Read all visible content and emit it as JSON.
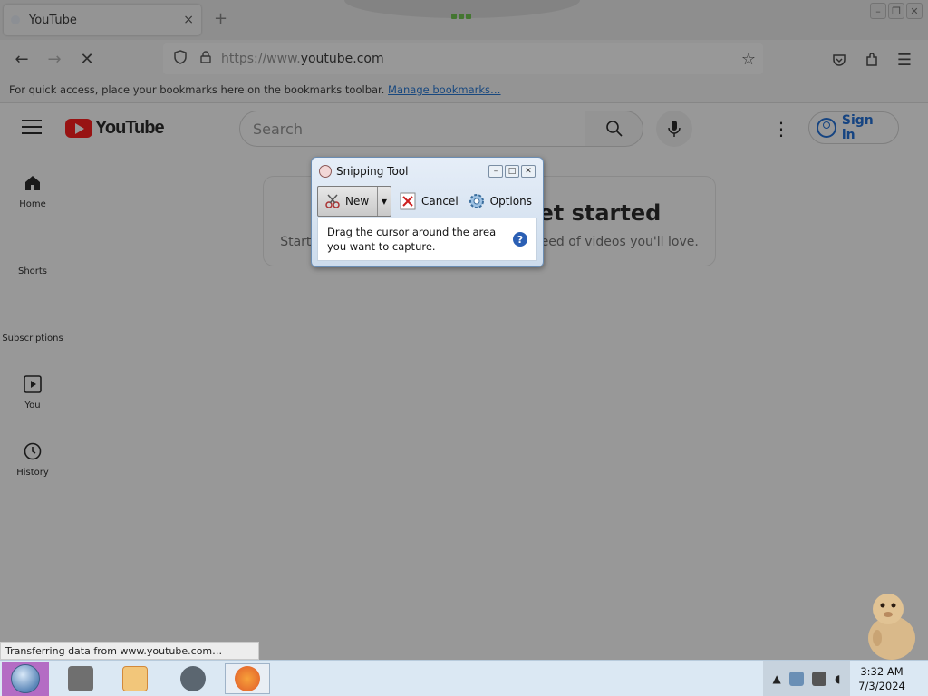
{
  "browser": {
    "tab_title": "YouTube",
    "tab_close": "×",
    "new_tab": "+",
    "url_prefix": "https://www.",
    "url_domain": "youtube.com",
    "bookmarks_text": "For quick access, place your bookmarks here on the bookmarks toolbar.",
    "manage_bookmarks": "Manage bookmarks…",
    "status_text": "Transferring data from www.youtube.com…"
  },
  "youtube": {
    "logo_text": "YouTube",
    "search_placeholder": "Search",
    "sign_in": "Sign in",
    "guide": [
      "Home",
      "Shorts",
      "Subscriptions",
      "You",
      "History"
    ],
    "empty_title": "Try searching to get started",
    "empty_subtitle": "Start watching videos to help us build a feed of videos you'll love."
  },
  "snipping_tool": {
    "title": "Snipping Tool",
    "new_label": "New",
    "cancel_label": "Cancel",
    "options_label": "Options",
    "message_line1": "Drag the cursor around the area",
    "message_line2": "you want to capture.",
    "help_glyph": "?"
  },
  "taskbar": {
    "time": "3:32 AM",
    "date": "7/3/2024"
  },
  "colors": {
    "youtube_red": "#ff0000",
    "link_blue": "#065fd4",
    "overlay": "#282828"
  },
  "icons": [
    "back-arrow-icon",
    "forward-arrow-icon",
    "stop-icon",
    "shield-icon",
    "lock-icon",
    "star-icon",
    "pocket-icon",
    "extensions-icon",
    "menu-icon",
    "search-icon",
    "mic-icon",
    "more-vert-icon",
    "person-icon",
    "home-icon",
    "shorts-icon",
    "subscriptions-icon",
    "you-icon",
    "history-icon",
    "scissors-icon",
    "cancel-x-icon",
    "gear-icon",
    "help-icon"
  ]
}
